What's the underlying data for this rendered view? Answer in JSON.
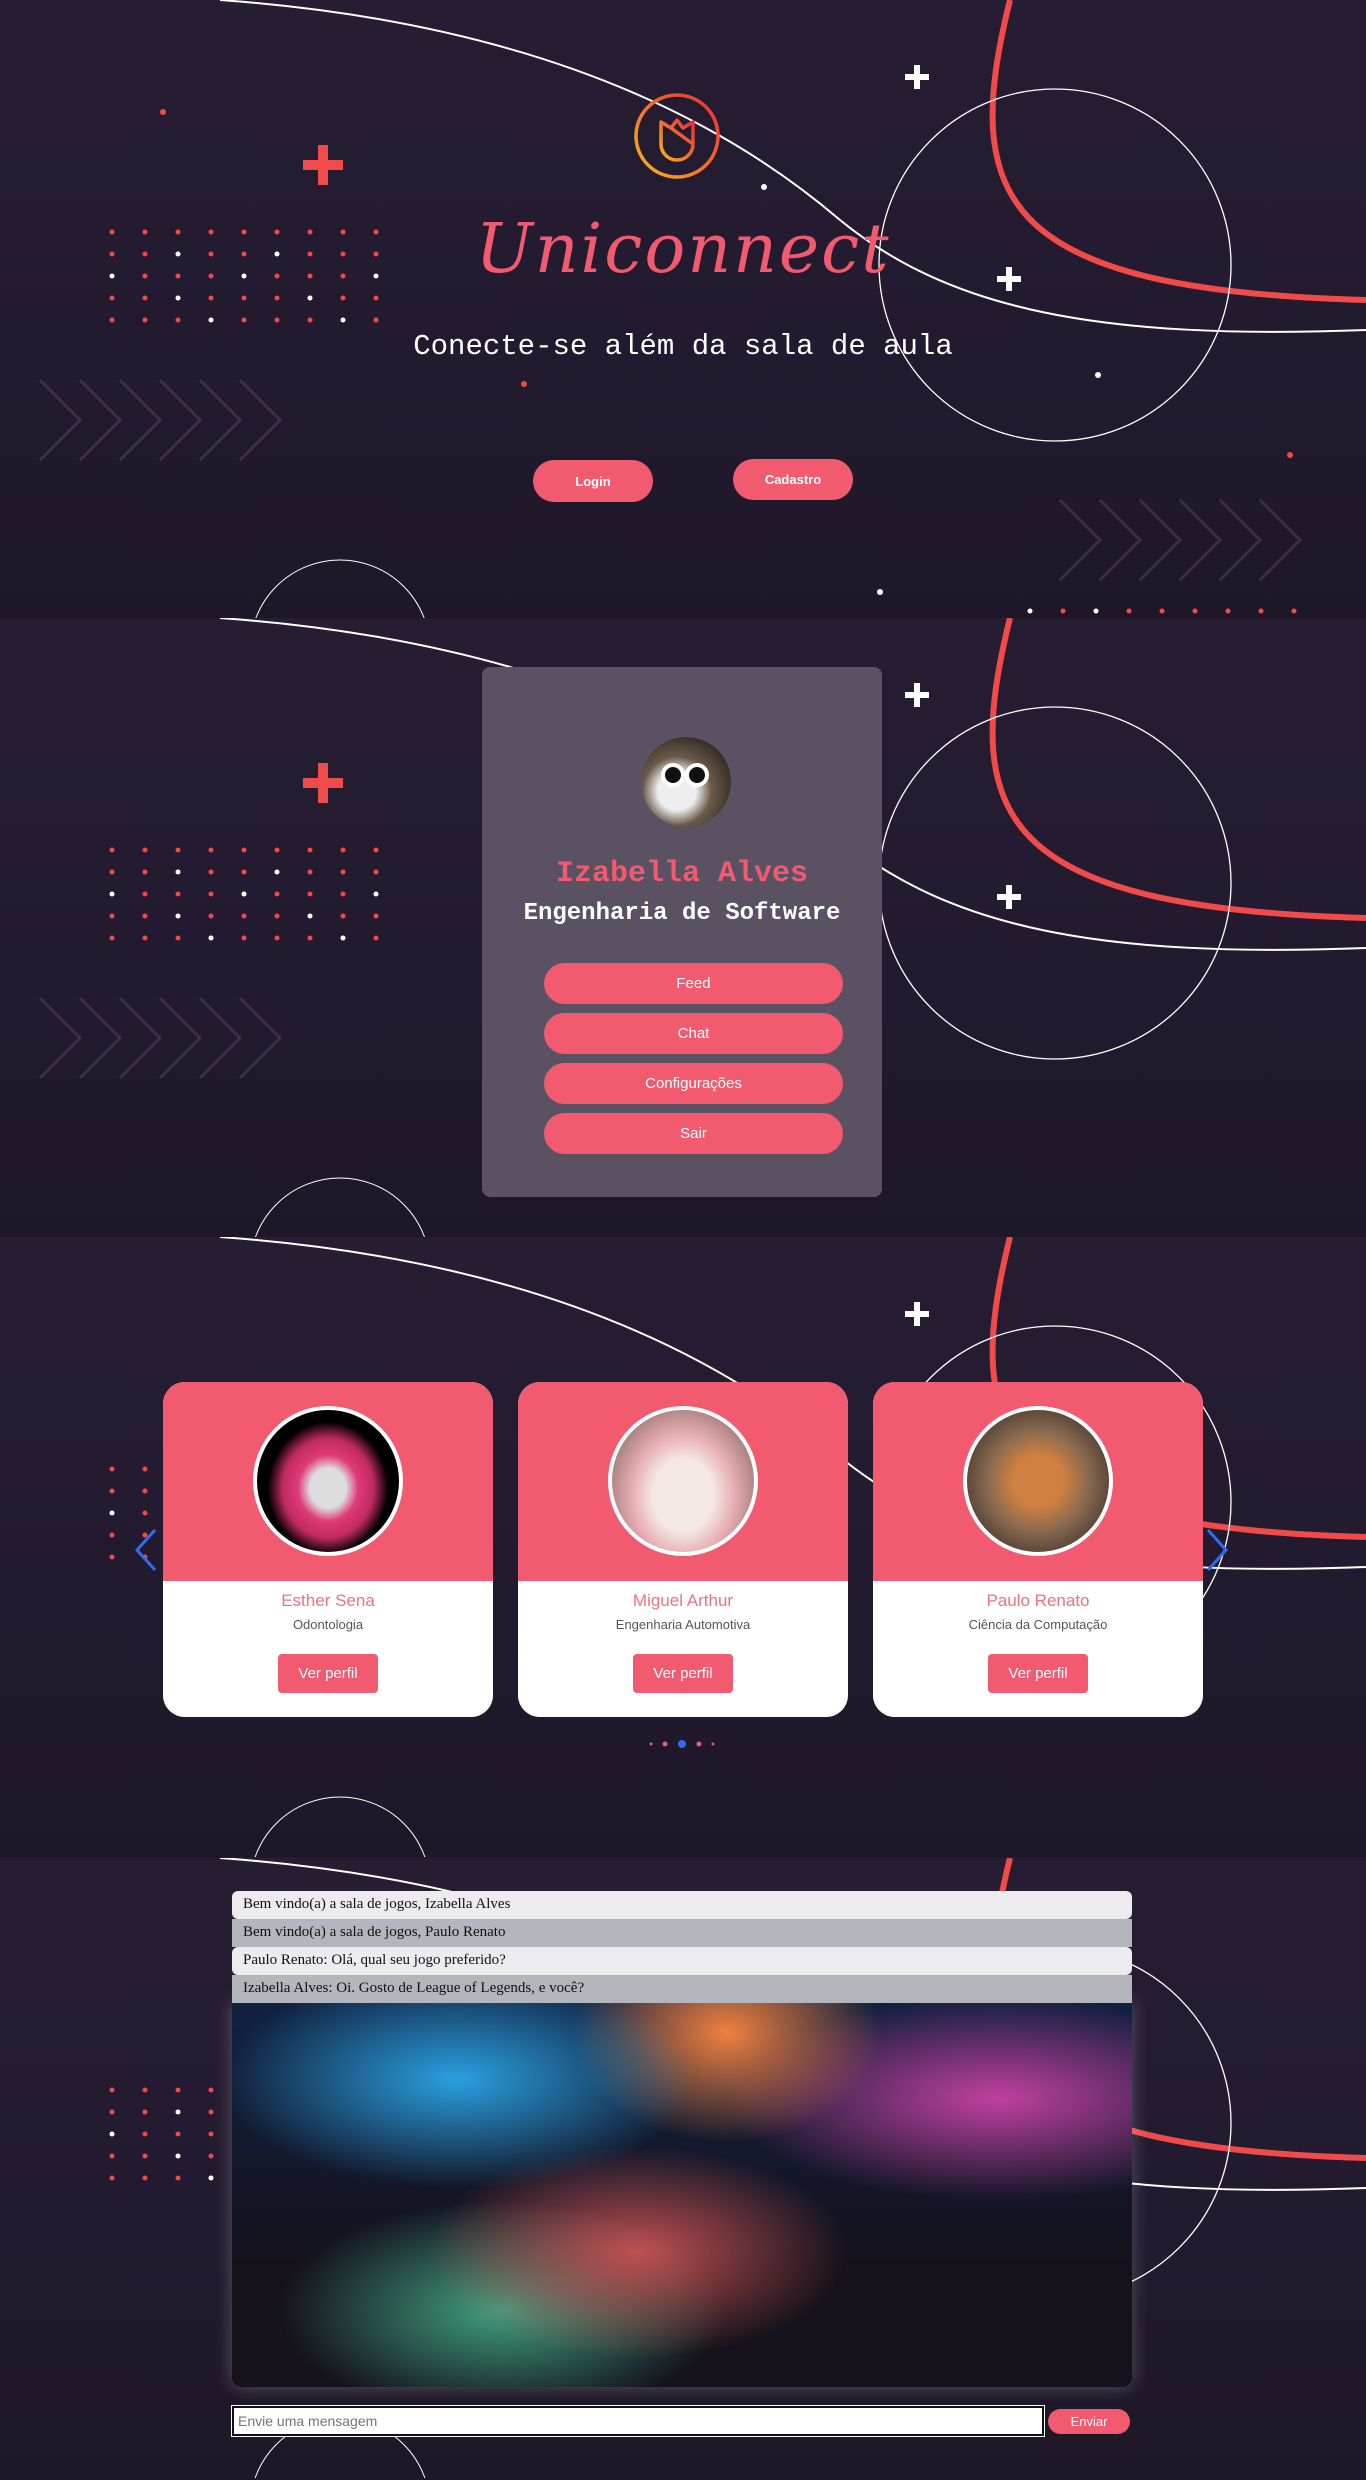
{
  "hero": {
    "logo": "tulip-logo",
    "title": "Uniconnect",
    "subtitle": "Conecte-se além da sala de aula",
    "login_label": "Login",
    "signup_label": "Cadastro"
  },
  "profile": {
    "name": "Izabella Alves",
    "course": "Engenharia de Software",
    "menu": [
      {
        "label": "Feed"
      },
      {
        "label": "Chat"
      },
      {
        "label": "Configurações"
      },
      {
        "label": "Sair"
      }
    ]
  },
  "carousel": {
    "cards": [
      {
        "name": "Esther Sena",
        "course": "Odontologia",
        "button": "Ver perfil"
      },
      {
        "name": "Miguel Arthur",
        "course": "Engenharia Automotiva",
        "button": "Ver perfil"
      },
      {
        "name": "Paulo Renato",
        "course": "Ciência da Computação",
        "button": "Ver perfil"
      }
    ],
    "active_page": 3,
    "page_count": 5
  },
  "chat": {
    "messages": [
      {
        "text": "Bem vindo(a) a sala de jogos, Izabella Alves"
      },
      {
        "text": "Bem vindo(a) a sala de jogos, Paulo Renato"
      },
      {
        "text": "Paulo Renato: Olá, qual seu jogo preferido?"
      },
      {
        "text": "Izabella Alves: Oi. Gosto de League of Legends, e você?"
      }
    ],
    "input_placeholder": "Envie uma mensagem",
    "send_label": "Enviar"
  },
  "colors": {
    "accent": "#f25a70",
    "background": "#221a2e",
    "card": "#5a5262",
    "arrow": "#2f6cf0"
  }
}
